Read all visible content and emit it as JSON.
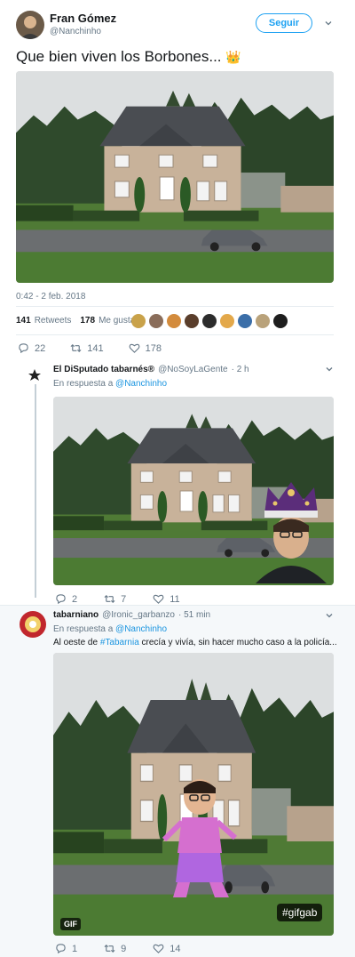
{
  "main_tweet": {
    "display_name": "Fran Gómez",
    "handle": "@Nanchinho",
    "follow_label": "Seguir",
    "text": "Que bien viven los Borbones...",
    "crown_emoji": "👑",
    "timestamp": "0:42 - 2 feb. 2018",
    "retweets_count": "141",
    "retweets_label": "Retweets",
    "likes_count": "178",
    "likes_label": "Me gusta",
    "actions": {
      "replies": "22",
      "retweets": "141",
      "likes": "178"
    }
  },
  "reply1": {
    "display_name": "El DiSputado tabarnés®",
    "handle": "@NoSoyLaGente",
    "time": "· 2 h",
    "reply_prefix": "En respuesta a",
    "reply_to": "@Nanchinho",
    "actions": {
      "replies": "2",
      "retweets": "7",
      "likes": "11"
    }
  },
  "reply2": {
    "display_name": "tabarniano",
    "handle": "@Ironic_garbanzo",
    "time": "· 51 min",
    "reply_prefix": "En respuesta a",
    "reply_to": "@Nanchinho",
    "text_before": "Al oeste de",
    "hashtag": "#Tabarnia",
    "text_after": "crecía y vivía, sin hacer mucho caso a la policía...",
    "gif_badge": "GIF",
    "gif_tag": "#gifgab",
    "actions": {
      "replies": "1",
      "retweets": "9",
      "likes": "14"
    }
  },
  "colors": {
    "accent": "#1da1f2",
    "link": "#1b95e0",
    "muted": "#657786",
    "thread_line": "#c4cfd6",
    "reply_background": "#f5f8fa"
  },
  "icons": [
    "reply-icon",
    "retweet-icon",
    "like-icon",
    "chevron-down-icon",
    "crown-emoji"
  ]
}
